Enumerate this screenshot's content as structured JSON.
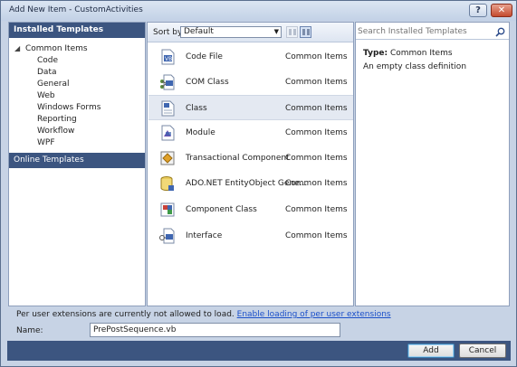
{
  "window": {
    "title": "Add New Item - CustomActivities",
    "help_label": "?",
    "close_label": "✕"
  },
  "left": {
    "header": "Installed Templates",
    "parent": "Common Items",
    "children": [
      "Code",
      "Data",
      "General",
      "Web",
      "Windows Forms",
      "Reporting",
      "Workflow",
      "WPF"
    ],
    "online": "Online Templates"
  },
  "sort": {
    "label": "Sort by:",
    "value": "Default"
  },
  "templates": [
    {
      "name": "Code File",
      "category": "Common Items",
      "icon": "code-file-icon"
    },
    {
      "name": "COM Class",
      "category": "Common Items",
      "icon": "com-class-icon"
    },
    {
      "name": "Class",
      "category": "Common Items",
      "icon": "class-icon"
    },
    {
      "name": "Module",
      "category": "Common Items",
      "icon": "module-icon"
    },
    {
      "name": "Transactional Component",
      "category": "Common Items",
      "icon": "transactional-component-icon"
    },
    {
      "name": "ADO.NET EntityObject Gene...",
      "category": "Common Items",
      "icon": "ado-net-icon"
    },
    {
      "name": "Component Class",
      "category": "Common Items",
      "icon": "component-class-icon"
    },
    {
      "name": "Interface",
      "category": "Common Items",
      "icon": "interface-icon"
    }
  ],
  "search": {
    "placeholder": "Search Installed Templates"
  },
  "details": {
    "type_key": "Type:",
    "type_value": "Common Items",
    "description": "An empty class definition"
  },
  "extensions": {
    "message": "Per user extensions are currently not allowed to load.",
    "link": "Enable loading of per user extensions"
  },
  "name_field": {
    "label": "Name:",
    "value": "PrePostSequence.vb"
  },
  "buttons": {
    "add": "Add",
    "cancel": "Cancel"
  }
}
